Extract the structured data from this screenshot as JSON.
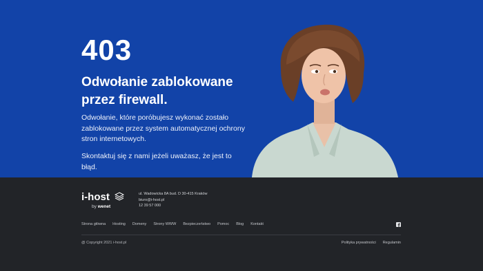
{
  "hero": {
    "code": "403",
    "title": "Odwołanie zablokowane przez firewall.",
    "description": "Odwołanie, które porόbujesz wykonać zostało zablokowane przez system automatycznej ochrony stron internetowych.",
    "contact_text": "Skontaktuj się z nami jeżeli uważasz, że jest to błąd.",
    "colors": {
      "background": "#1243a8",
      "text": "#ffffff"
    }
  },
  "footer": {
    "logo": {
      "name": "i-host",
      "by": "by",
      "brand": "wenet"
    },
    "contact": {
      "address": "ul. Wadowicka 8A bud. D 30-415 Kraków",
      "email": "biuro@i-host.pl",
      "phone": "12 39 57 000"
    },
    "nav": [
      "Strona główna",
      "Hosting",
      "Domeny",
      "Strony WWW",
      "Bezpieczeństwo",
      "Pomoc",
      "Blog",
      "Kontakt"
    ],
    "social_icon": "facebook-icon",
    "copyright": "@ Copyright 2021 i-host.pl",
    "legal": [
      "Polityka prywatności",
      "Regulamin"
    ],
    "colors": {
      "background": "#222428"
    }
  }
}
